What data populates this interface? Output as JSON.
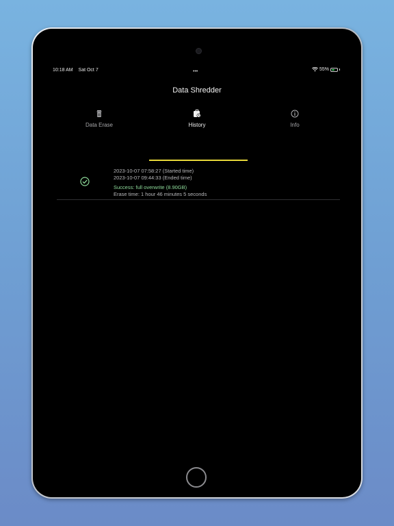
{
  "status_bar": {
    "time": "10:18 AM",
    "date": "Sat Oct 7",
    "dots": "•••",
    "battery_percent": "55%",
    "battery_level": 0.55
  },
  "nav": {
    "title": "Data Shredder"
  },
  "tabs": [
    {
      "label": "Data Erase",
      "icon": "trash-icon",
      "active": false
    },
    {
      "label": "History",
      "icon": "history-icon",
      "active": true
    },
    {
      "label": "Info",
      "icon": "info-icon",
      "active": false
    }
  ],
  "history": [
    {
      "started": "2023-10-07 07:58:27 (Started time)",
      "ended": "2023-10-07 09:44:33 (Ended time)",
      "result": "Success: full overwrite (8.90GB)",
      "erase_time": "Erase time: 1 hour 46 minutes 5 seconds",
      "status_icon": "check-circle-icon",
      "colors": {
        "success": "#34c759"
      }
    }
  ],
  "colors": {
    "accent": "#e8d93a",
    "background": "#000000"
  }
}
